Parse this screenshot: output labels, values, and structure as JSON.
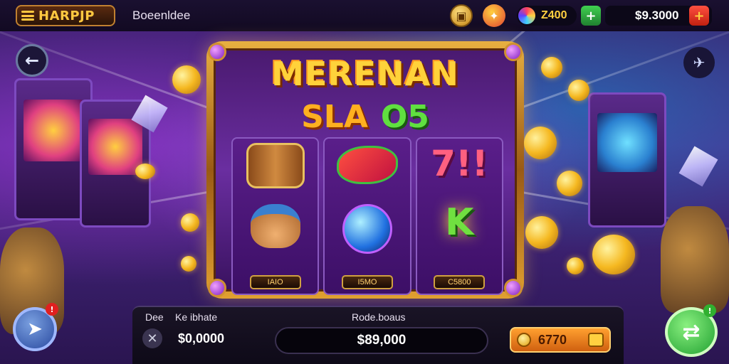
{
  "header": {
    "logo_text": "HARPJP",
    "game_title": "Boeenldee",
    "gem_balance": "Z400",
    "coin_balance": "$9.3000"
  },
  "machine": {
    "title": "MERENAN",
    "subtitle_a": "SLA",
    "subtitle_b": "O5",
    "reels": [
      {
        "plate": "IAIO"
      },
      {
        "plate": "I5MO"
      },
      {
        "plate": "C5800"
      }
    ],
    "seven_symbol": "7!!",
    "k_symbol": "K"
  },
  "panel": {
    "bet_label_a": "Dee",
    "bet_label_b": "Ke ibhate",
    "bet_value": "$0,0000",
    "win_label": "Rode.boaus",
    "win_value": "$89,000",
    "spin_value": "6770"
  },
  "notifications": {
    "left_badge": "!",
    "right_badge": "!"
  }
}
